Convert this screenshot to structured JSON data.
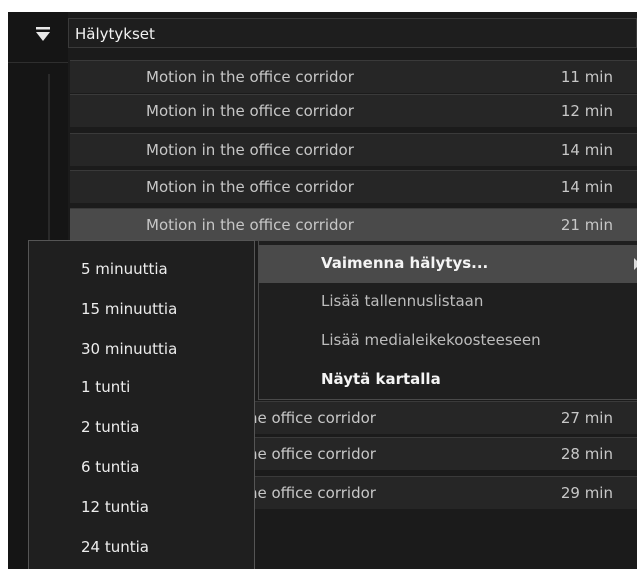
{
  "panel": {
    "title": "Hälytykset"
  },
  "alarms": [
    {
      "description": "Motion in the office corridor",
      "time": "11 min"
    },
    {
      "description": "Motion in the office corridor",
      "time": "12 min"
    },
    {
      "description": "Motion in the office corridor",
      "time": "14 min"
    },
    {
      "description": "Motion in the office corridor",
      "time": "14 min"
    },
    {
      "description": "Motion in the office corridor",
      "time": "21 min"
    },
    {
      "description": "he office corridor",
      "time": "27 min"
    },
    {
      "description": "he office corridor",
      "time": "28 min"
    },
    {
      "description": "he office corridor",
      "time": "29 min"
    }
  ],
  "context_menu": {
    "items": [
      {
        "label": "Vaimenna hälytys..."
      },
      {
        "label": "Lisää tallennuslistaan"
      },
      {
        "label": "Lisää medialeikekoosteeseen"
      },
      {
        "label": "Näytä kartalla"
      }
    ]
  },
  "submenu": {
    "items": [
      {
        "label": "5 minuuttia"
      },
      {
        "label": "15 minuuttia"
      },
      {
        "label": "30 minuuttia"
      },
      {
        "label": "1 tunti"
      },
      {
        "label": "2 tuntia"
      },
      {
        "label": "6 tuntia"
      },
      {
        "label": "12 tuntia"
      },
      {
        "label": "24 tuntia"
      }
    ]
  }
}
